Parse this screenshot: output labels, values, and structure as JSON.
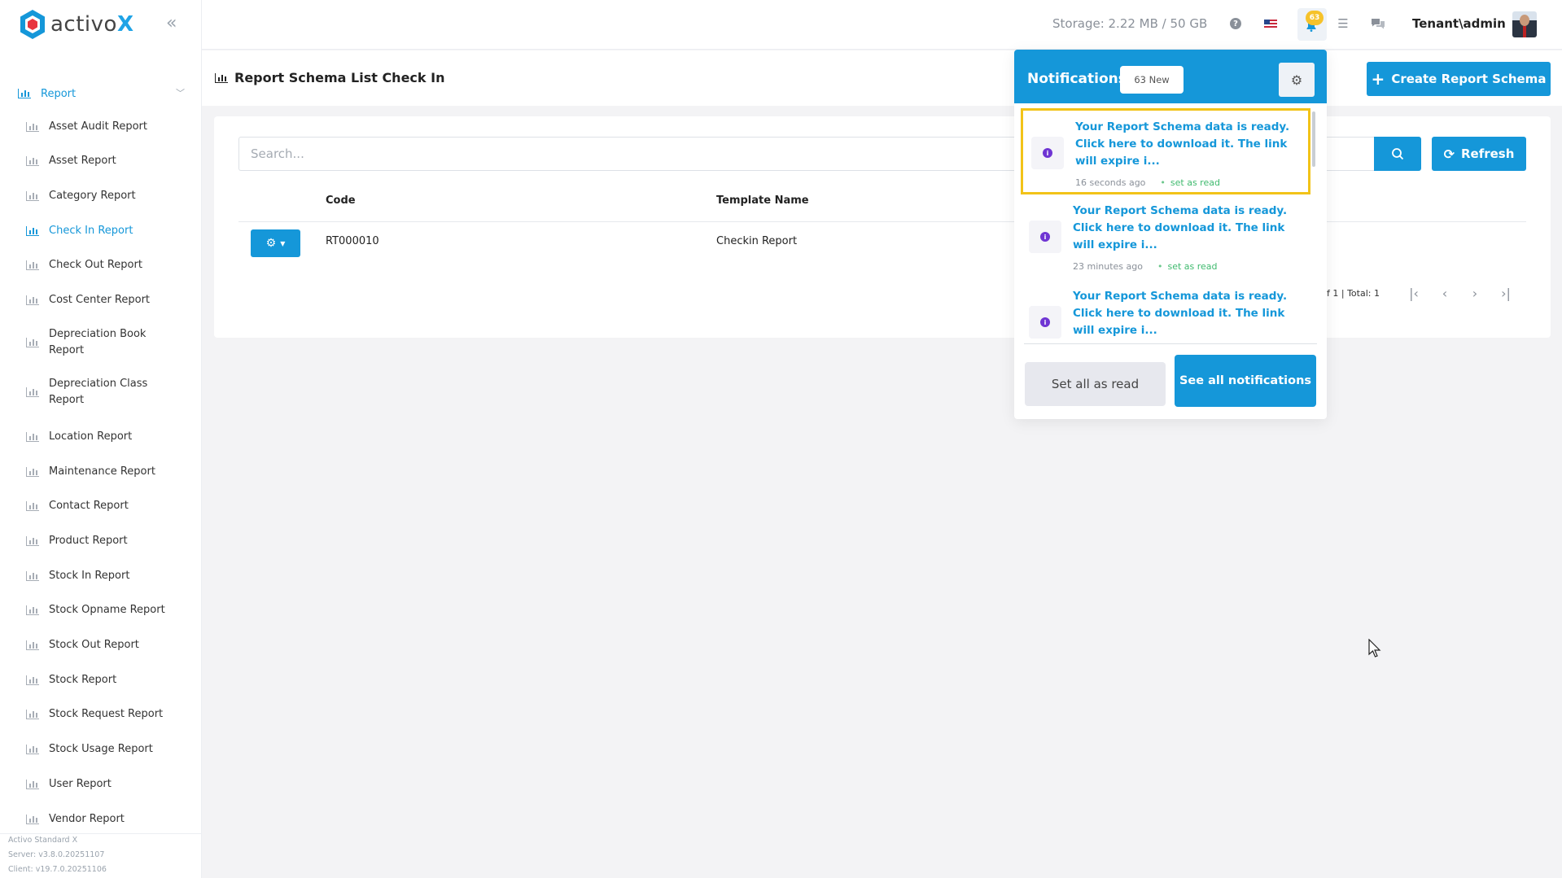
{
  "brand": {
    "name_prefix": "activo",
    "name_suffix": "X"
  },
  "sidebar": {
    "parent_label": "Report",
    "items": [
      {
        "label": "Asset Audit Report",
        "active": false
      },
      {
        "label": "Asset Report",
        "active": false
      },
      {
        "label": "Category Report",
        "active": false
      },
      {
        "label": "Check In Report",
        "active": true
      },
      {
        "label": "Check Out Report",
        "active": false
      },
      {
        "label": "Cost Center Report",
        "active": false
      },
      {
        "label": "Depreciation Book Report",
        "active": false
      },
      {
        "label": "Depreciation Class Report",
        "active": false
      },
      {
        "label": "Location Report",
        "active": false
      },
      {
        "label": "Maintenance Report",
        "active": false
      },
      {
        "label": "Contact Report",
        "active": false
      },
      {
        "label": "Product Report",
        "active": false
      },
      {
        "label": "Stock In Report",
        "active": false
      },
      {
        "label": "Stock Opname Report",
        "active": false
      },
      {
        "label": "Stock Out Report",
        "active": false
      },
      {
        "label": "Stock Report",
        "active": false
      },
      {
        "label": "Stock Request Report",
        "active": false
      },
      {
        "label": "Stock Usage Report",
        "active": false
      },
      {
        "label": "User Report",
        "active": false
      },
      {
        "label": "Vendor Report",
        "active": false
      }
    ],
    "version": {
      "edition": "Activo Standard X",
      "server": "Server: v3.8.0.20251107",
      "client": "Client: v19.7.0.20251106"
    }
  },
  "header": {
    "storage": "Storage: 2.22 MB / 50 GB",
    "notification_badge": "63",
    "user": "Tenant\\admin"
  },
  "page": {
    "title": "Report Schema List Check In",
    "create_button": "Create Report Schema",
    "search_placeholder": "Search...",
    "refresh_button": "Refresh",
    "columns": [
      "Code",
      "Template Name"
    ],
    "rows": [
      {
        "code": "RT000010",
        "template_name": "Checkin Report"
      }
    ],
    "pager_info": "f 1 | Total: 1"
  },
  "notifications": {
    "title": "Notifications",
    "new_count": "63 New",
    "items": [
      {
        "text": "Your Report Schema data is ready. Click here to download it. The link will expire i...",
        "time": "16 seconds ago",
        "action": "set as read"
      },
      {
        "text": "Your Report Schema data is ready. Click here to download it. The link will expire i...",
        "time": "23 minutes ago",
        "action": "set as read"
      },
      {
        "text": "Your Report Schema data is ready. Click here to download it. The link will expire i...",
        "time": "",
        "action": ""
      }
    ],
    "set_all_read": "Set all as read",
    "see_all": "See all notifications"
  },
  "colors": {
    "primary": "#1597d9",
    "highlight": "#f2c318",
    "badge": "#f6c22a",
    "read_green": "#3fba6e",
    "info_purple": "#6f35d3"
  }
}
